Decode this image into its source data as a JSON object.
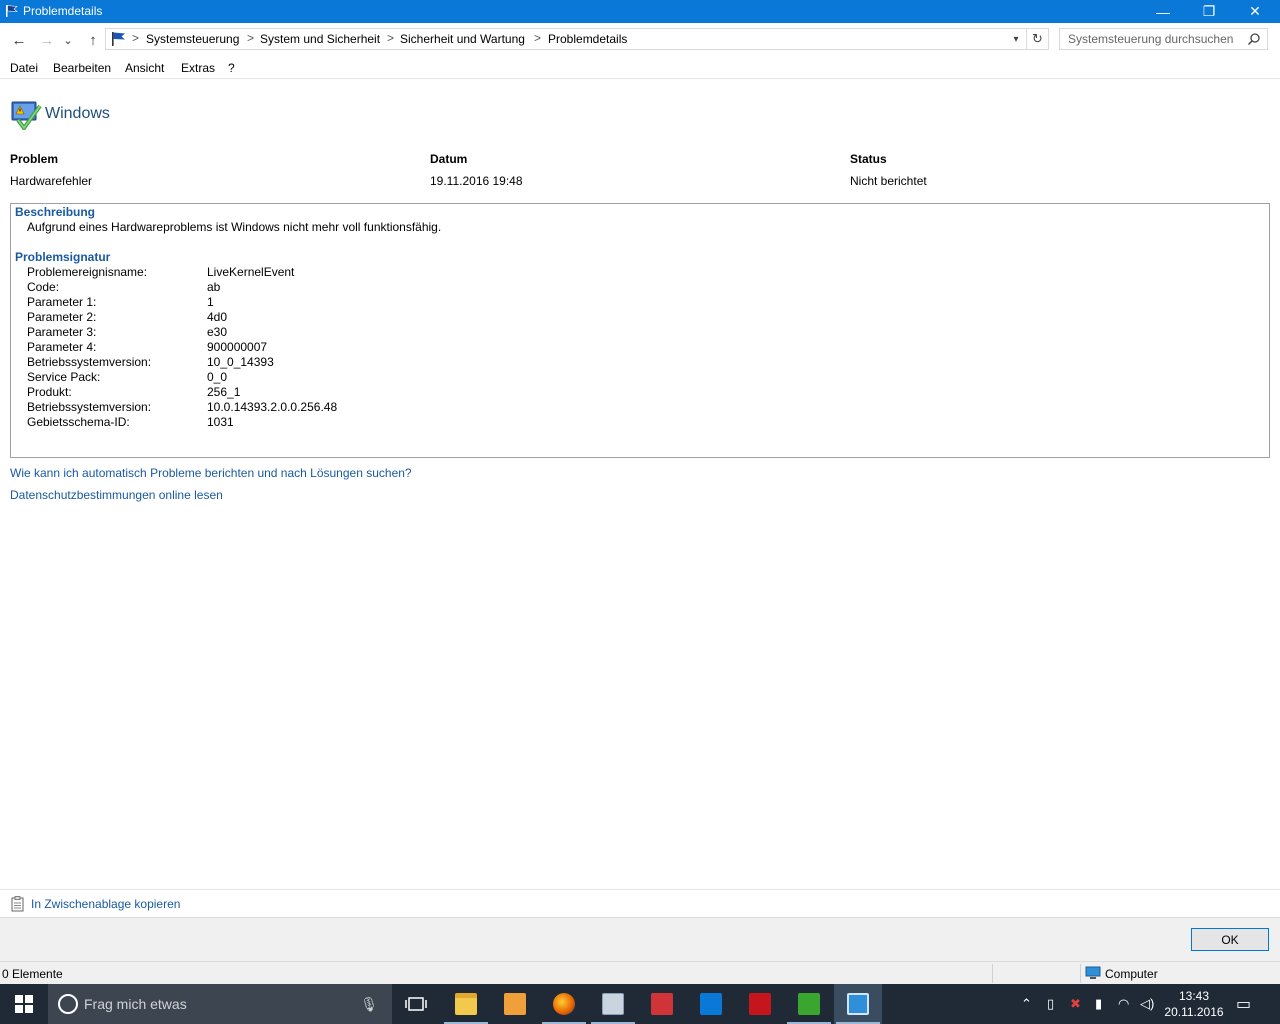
{
  "window": {
    "title": "Problemdetails",
    "min_glyph": "—",
    "max_glyph": "❐",
    "close_glyph": "✕"
  },
  "nav": {
    "back_glyph": "←",
    "forward_glyph": "→",
    "recent_glyph": "⌄",
    "up_glyph": "↑"
  },
  "address": {
    "crumbs": [
      "Systemsteuerung",
      "System und Sicherheit",
      "Sicherheit und Wartung",
      "Problemdetails"
    ],
    "separator": ">",
    "refresh_glyph": "↻"
  },
  "search": {
    "placeholder": "Systemsteuerung durchsuchen"
  },
  "menu": [
    "Datei",
    "Bearbeiten",
    "Ansicht",
    "Extras",
    "?"
  ],
  "app": {
    "title": "Windows"
  },
  "summary": {
    "headers": [
      "Problem",
      "Datum",
      "Status"
    ],
    "values": [
      "Hardwarefehler",
      "19.11.2016 19:48",
      "Nicht berichtet"
    ]
  },
  "details": {
    "description_heading": "Beschreibung",
    "description_text": "Aufgrund eines Hardwareproblems ist Windows nicht mehr voll funktionsfähig.",
    "signature_heading": "Problemsignatur",
    "signature": [
      {
        "key": "Problemereignisname:",
        "value": "LiveKernelEvent"
      },
      {
        "key": "Code:",
        "value": "ab"
      },
      {
        "key": "Parameter 1:",
        "value": "1"
      },
      {
        "key": "Parameter 2:",
        "value": "4d0"
      },
      {
        "key": "Parameter 3:",
        "value": "e30"
      },
      {
        "key": "Parameter 4:",
        "value": "900000007"
      },
      {
        "key": "Betriebssystemversion:",
        "value": "10_0_14393"
      },
      {
        "key": "Service Pack:",
        "value": "0_0"
      },
      {
        "key": "Produkt:",
        "value": "256_1"
      },
      {
        "key": "Betriebssystemversion:",
        "value": "10.0.14393.2.0.0.256.48"
      },
      {
        "key": "Gebietsschema-ID:",
        "value": "1031"
      }
    ]
  },
  "links": {
    "report_help": "Wie kann ich automatisch Probleme berichten und nach Lösungen suchen?",
    "privacy": "Datenschutzbestimmungen online lesen",
    "copy": "In Zwischenablage kopieren"
  },
  "buttons": {
    "ok": "OK"
  },
  "status": {
    "items": "0 Elemente",
    "zone": "Computer"
  },
  "taskbar": {
    "search_placeholder": "Frag mich etwas",
    "mic_glyph": "🎙",
    "time": "13:43",
    "date": "20.11.2016"
  },
  "colors": {
    "titlebar": "#0a78d7",
    "link": "#1a5aa0",
    "taskbar": "#1f2a36"
  }
}
